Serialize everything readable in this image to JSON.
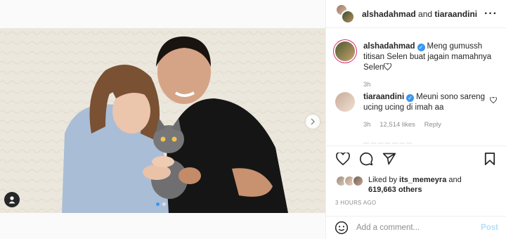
{
  "header": {
    "user1": "alshadahmad",
    "conjunction": "and",
    "user2": "tiaraandini",
    "more_icon": "more-horizontal-icon"
  },
  "caption": {
    "username": "alshadahmad",
    "text": "Meng gumussh titisan Selen buat jagain mamahnya Selen",
    "time": "3h"
  },
  "comment": {
    "username": "tiaraandini",
    "text": "Meuni sono sareng ucing ucing di imah aa",
    "time": "3h",
    "likes": "12,514 likes",
    "reply": "Reply"
  },
  "actions": {
    "icons": [
      "heart-icon",
      "comment-icon",
      "share-icon",
      "bookmark-icon"
    ]
  },
  "likes": {
    "prefix": "Liked by",
    "user": "its_memeyra",
    "and": "and",
    "others": "619,663 others"
  },
  "time_ago": "3 HOURS AGO",
  "add_comment": {
    "placeholder": "Add a comment...",
    "post": "Post"
  },
  "colors": {
    "accent": "#3897f0",
    "post_disabled": "#b2dffc",
    "muted": "#8e8e8e",
    "text": "#262626"
  }
}
